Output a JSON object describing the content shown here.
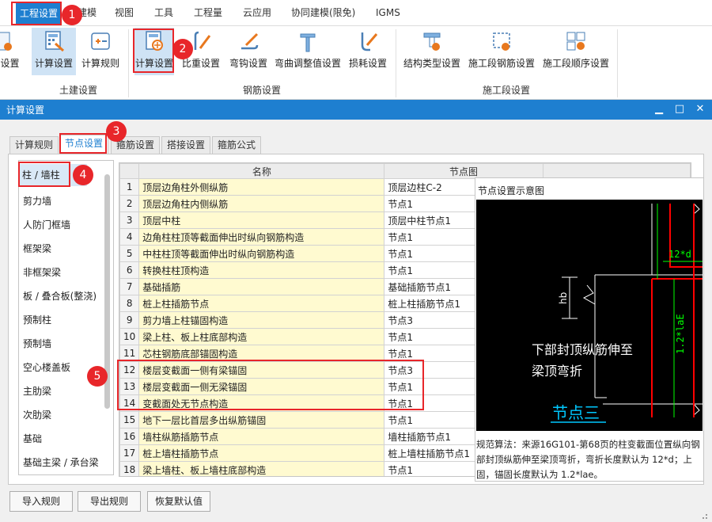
{
  "menu": {
    "items": [
      "工程设置",
      "建模",
      "视图",
      "工具",
      "工程量",
      "云应用",
      "协同建模(限免)",
      "IGMS"
    ]
  },
  "ribbon": {
    "partial_label": "设置",
    "groups": [
      {
        "label": "土建设置",
        "buttons": [
          "计算设置",
          "计算规则"
        ]
      },
      {
        "label": "钢筋设置",
        "buttons": [
          "计算设置",
          "比重设置",
          "弯钩设置",
          "弯曲调整值设置",
          "损耗设置"
        ]
      },
      {
        "label": "施工段设置",
        "buttons": [
          "结构类型设置",
          "施工段钢筋设置",
          "施工段顺序设置"
        ]
      }
    ]
  },
  "dialog": {
    "title": "计算设置",
    "tabs": [
      "计算规则",
      "节点设置",
      "箍筋设置",
      "搭接设置",
      "箍筋公式"
    ],
    "categories": [
      "柱 / 墙柱",
      "剪力墙",
      "人防门框墙",
      "框架梁",
      "非框架梁",
      "板 / 叠合板(整浇)",
      "预制柱",
      "预制墙",
      "空心楼盖板",
      "主肋梁",
      "次肋梁",
      "基础",
      "基础主梁 / 承台梁"
    ],
    "table": {
      "col_name": "名称",
      "col_node": "节点图",
      "rows": [
        {
          "no": "1",
          "name": "顶层边角柱外侧纵筋",
          "node": "顶层边柱C-2"
        },
        {
          "no": "2",
          "name": "顶层边角柱内侧纵筋",
          "node": "节点1"
        },
        {
          "no": "3",
          "name": "顶层中柱",
          "node": "顶层中柱节点1"
        },
        {
          "no": "4",
          "name": "边角柱柱顶等截面伸出时纵向钢筋构造",
          "node": "节点1"
        },
        {
          "no": "5",
          "name": "中柱柱顶等截面伸出时纵向钢筋构造",
          "node": "节点1"
        },
        {
          "no": "6",
          "name": "转换柱柱顶构造",
          "node": "节点1"
        },
        {
          "no": "7",
          "name": "基础插筋",
          "node": "基础插筋节点1"
        },
        {
          "no": "8",
          "name": "桩上柱插筋节点",
          "node": "桩上柱插筋节点1"
        },
        {
          "no": "9",
          "name": "剪力墙上柱锚固构造",
          "node": "节点3"
        },
        {
          "no": "10",
          "name": "梁上柱、板上柱底部构造",
          "node": "节点1"
        },
        {
          "no": "11",
          "name": "芯柱钢筋底部锚固构造",
          "node": "节点1"
        },
        {
          "no": "12",
          "name": "楼层变截面一侧有梁锚固",
          "node": "节点3"
        },
        {
          "no": "13",
          "name": "楼层变截面一侧无梁锚固",
          "node": "节点1"
        },
        {
          "no": "14",
          "name": "变截面处无节点构造",
          "node": "节点1"
        },
        {
          "no": "15",
          "name": "地下一层比首层多出纵筋锚固",
          "node": "节点1"
        },
        {
          "no": "16",
          "name": "墙柱纵筋插筋节点",
          "node": "墙柱插筋节点1"
        },
        {
          "no": "17",
          "name": "桩上墙柱插筋节点",
          "node": "桩上墙柱插筋节点1"
        },
        {
          "no": "18",
          "name": "梁上墙柱、板上墙柱底部构造",
          "node": "节点1"
        }
      ]
    },
    "preview": {
      "title": "节点设置示意图",
      "label_12d": "12*d",
      "label_hb": "hb",
      "label_lae": "1.2*laE",
      "caption_line1": "下部封顶纵筋伸至",
      "caption_line2": "梁顶弯折",
      "node_title": "节点三",
      "description": "规范算法：来源16G101-第68页的柱变截面位置纵向钢\n部封顶纵筋伸至梁顶弯折，弯折长度默认为 12*d；上\n固，锚固长度默认为 1.2*lae。"
    },
    "buttons": [
      "导入规则",
      "导出规则",
      "恢复默认值"
    ]
  },
  "annotations": [
    "1",
    "2",
    "3",
    "4",
    "5"
  ],
  "colors": {
    "accent": "#1e7fd0",
    "highlight": "#e8262a",
    "cad_green": "#00ff00",
    "cad_red": "#ff0000",
    "cad_cyan": "#00c8ff"
  }
}
